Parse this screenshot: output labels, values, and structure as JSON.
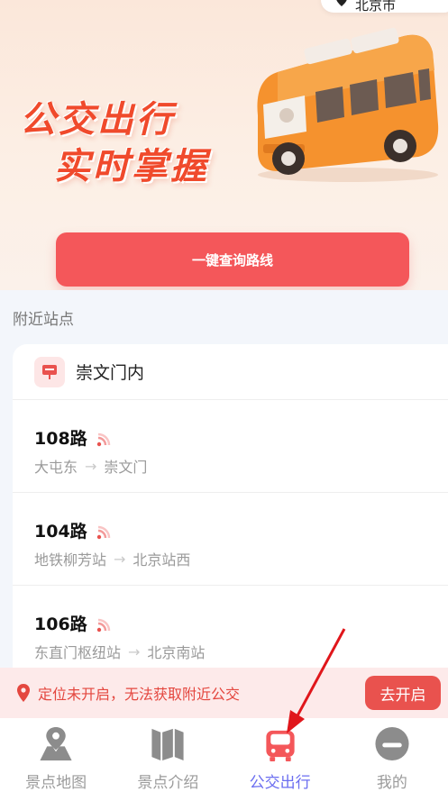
{
  "header": {
    "city": "北京市",
    "slogan_line1": "公交出行",
    "slogan_line2": "实时掌握",
    "query_button": "一键查询路线"
  },
  "nearby": {
    "title": "附近站点",
    "stop_name": "崇文门内",
    "routes": [
      {
        "number": "108路",
        "from": "大屯东",
        "to": "崇文门"
      },
      {
        "number": "104路",
        "from": "地铁柳芳站",
        "to": "北京站西"
      },
      {
        "number": "106路",
        "from": "东直门枢纽站",
        "to": "北京南站"
      }
    ]
  },
  "location_banner": {
    "message": "定位未开启，无法获取附近公交",
    "button": "去开启"
  },
  "tabs": [
    {
      "label": "景点地图",
      "icon": "map-pin-icon",
      "active": false
    },
    {
      "label": "景点介绍",
      "icon": "book-icon",
      "active": false
    },
    {
      "label": "公交出行",
      "icon": "bus-icon",
      "active": true
    },
    {
      "label": "我的",
      "icon": "profile-icon",
      "active": false
    }
  ],
  "colors": {
    "accent": "#f4575a",
    "active_tab": "#6b6ef0",
    "warning": "#e4473f"
  }
}
